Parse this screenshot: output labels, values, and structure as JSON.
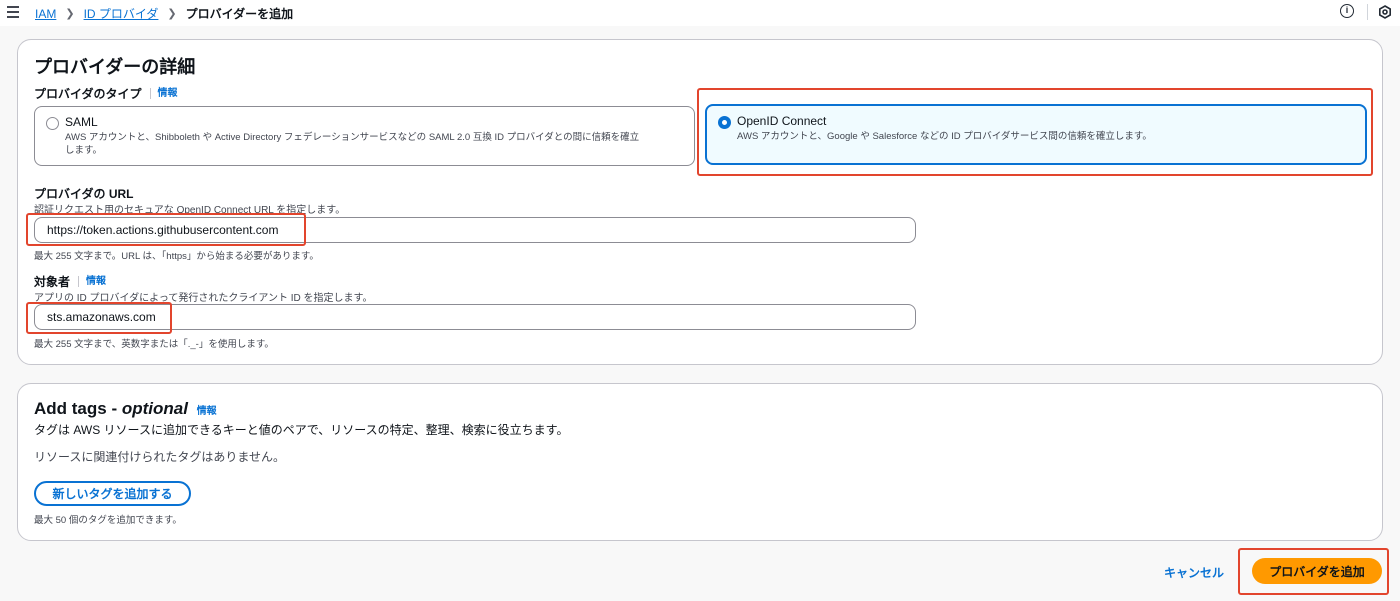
{
  "breadcrumbs": {
    "iam": "IAM",
    "providers": "ID プロバイダ",
    "current": "プロバイダーを追加"
  },
  "header_icons": [
    "info-icon",
    "settings-icon"
  ],
  "details": {
    "title": "プロバイダーの詳細",
    "type_label": "プロバイダのタイプ",
    "info": "情報",
    "options": [
      {
        "title": "SAML",
        "desc_line1": "AWS アカウントと、Shibboleth や Active Directory フェデレーションサービスなどの SAML 2.0 互換 ID プロバイダとの間に信頼を確立",
        "desc_line2": "します。",
        "selected": false
      },
      {
        "title": "OpenID Connect",
        "desc_line1": "AWS アカウントと、Google や Salesforce などの ID プロバイダサービス間の信頼を確立します。",
        "selected": true
      }
    ],
    "url": {
      "label": "プロバイダの URL",
      "desc": "認証リクエスト用のセキュアな OpenID Connect URL を指定します。",
      "value": "https://token.actions.githubusercontent.com",
      "hint": "最大 255 文字まで。URL は、「https」から始まる必要があります。"
    },
    "audience": {
      "label": "対象者",
      "info": "情報",
      "desc": "アプリの ID プロバイダによって発行されたクライアント ID を指定します。",
      "value": "sts.amazonaws.com",
      "hint": "最大 255 文字まで、英数字または「._-」を使用します。"
    }
  },
  "tags": {
    "title_prefix": "Add tags - ",
    "title_optional": "optional",
    "info": "情報",
    "desc": "タグは AWS リソースに追加できるキーと値のペアで、リソースの特定、整理、検索に役立ちます。",
    "empty": "リソースに関連付けられたタグはありません。",
    "add_button": "新しいタグを追加する",
    "limit_hint": "最大 50 個のタグを追加できます。"
  },
  "footer": {
    "cancel": "キャンセル",
    "submit": "プロバイダを追加"
  },
  "colors": {
    "link": "#0972d3",
    "primary": "#ff9900",
    "annotation": "#e2452d"
  }
}
